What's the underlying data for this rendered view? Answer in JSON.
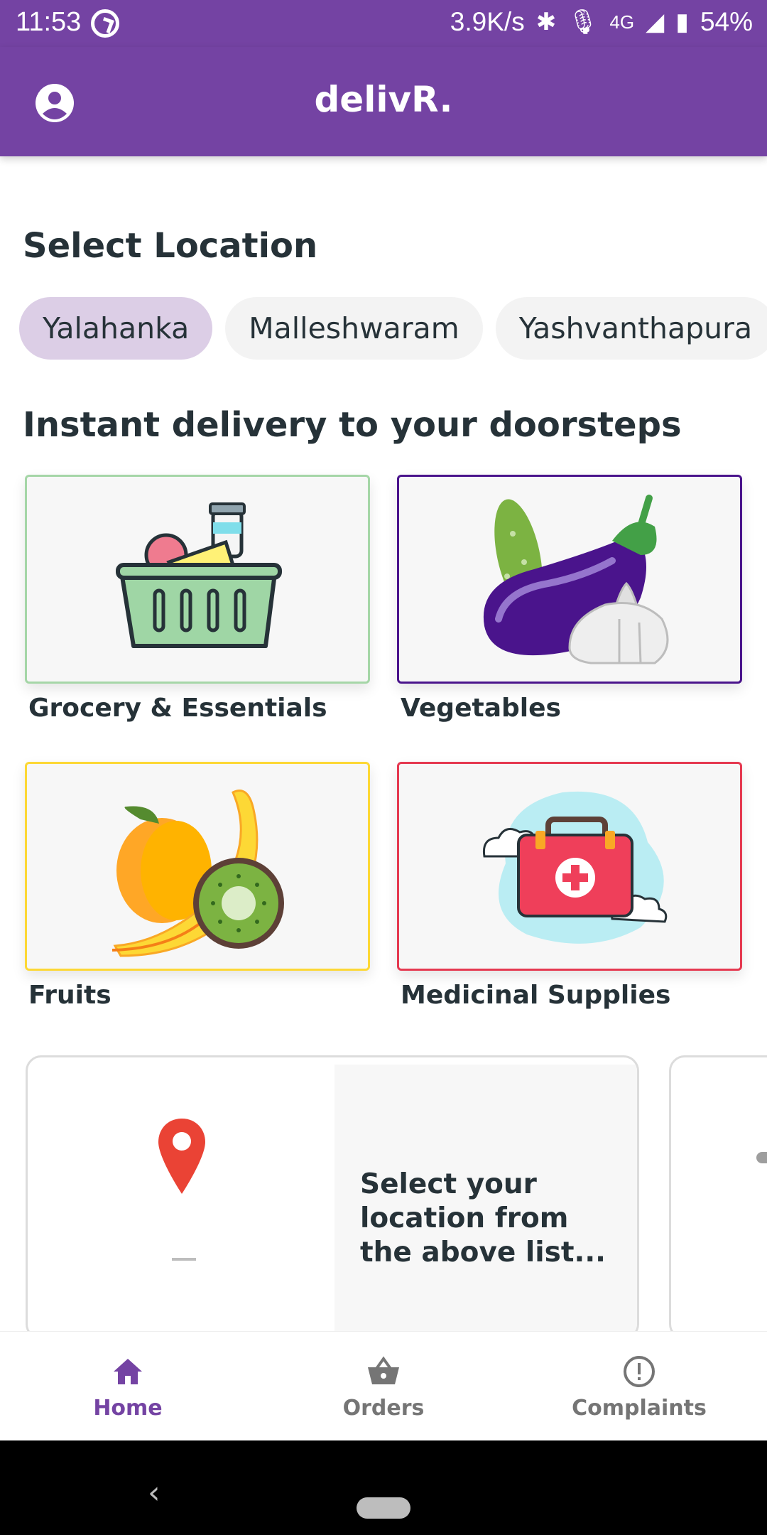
{
  "status_bar": {
    "time": "11:53",
    "speed": "3.9K/s",
    "network": "4G",
    "battery": "54%"
  },
  "app_bar": {
    "title": "delivR.",
    "account_icon": "account-circle-icon"
  },
  "location_section": {
    "title": "Select Location",
    "locations": [
      "Yalahanka",
      "Malleshwaram",
      "Yashvanthapura"
    ],
    "selected": "Yalahanka"
  },
  "categories_section": {
    "title": "Instant delivery to your doorsteps",
    "items": [
      {
        "label": "Grocery & Essentials",
        "icon": "grocery-basket-icon",
        "border_color": "#a5d6a7"
      },
      {
        "label": "Vegetables",
        "icon": "vegetables-icon",
        "border_color": "#4a148c"
      },
      {
        "label": "Fruits",
        "icon": "fruits-icon",
        "border_color": "#fdd835"
      },
      {
        "label": "Medicinal Supplies",
        "icon": "medical-kit-icon",
        "border_color": "#e53950"
      }
    ]
  },
  "location_card": {
    "message": "Select your location from the above list...",
    "icon": "location-pin-icon"
  },
  "bottom_nav": {
    "items": [
      {
        "label": "Home",
        "icon": "home-icon",
        "active": true
      },
      {
        "label": "Orders",
        "icon": "basket-icon",
        "active": false
      },
      {
        "label": "Complaints",
        "icon": "alert-circle-icon",
        "active": false
      }
    ]
  },
  "colors": {
    "primary": "#7443a3",
    "chip_selected": "#dccee6",
    "chip_default": "#f3f3f3",
    "text_dark": "#263238"
  }
}
